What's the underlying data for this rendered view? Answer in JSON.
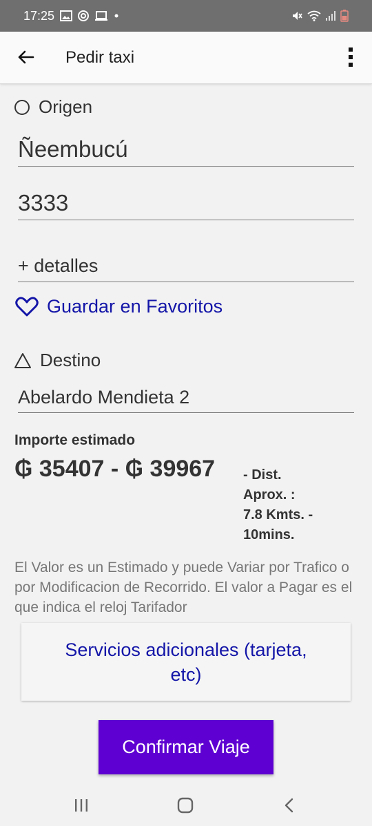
{
  "status_bar": {
    "time": "17:25"
  },
  "app_bar": {
    "title": "Pedir taxi"
  },
  "origin": {
    "label": "Origen",
    "street": "Ñeembucú",
    "number": "3333",
    "details_placeholder": "+ detalles"
  },
  "favorites": {
    "label": "Guardar en Favoritos"
  },
  "destination": {
    "label": "Destino",
    "address": "Abelardo Mendieta 2"
  },
  "estimate": {
    "title": "Importe estimado",
    "price_range": "₲ 35407 - ₲ 39967",
    "detail_line1": "- Dist.",
    "detail_line2": "Aprox. :",
    "detail_line3": "7.8 Kmts. -",
    "detail_line4": "10mins.",
    "disclaimer": "El Valor es un Estimado y puede Variar por Trafico o por Modificacion de Recorrido. El valor a Pagar es el que indica el reloj Tarifador"
  },
  "buttons": {
    "services": "Servicios adicionales (tarjeta, etc)",
    "confirm": "Confirmar Viaje"
  },
  "icons": {
    "back": "arrow-back-icon",
    "menu": "more-vert-icon",
    "origin": "circle-outline-icon",
    "destination": "triangle-outline-icon",
    "favorite": "heart-outline-icon"
  },
  "colors": {
    "accent": "#5e00d1",
    "link": "#1416a8",
    "status_bar": "#6f6f6f"
  }
}
